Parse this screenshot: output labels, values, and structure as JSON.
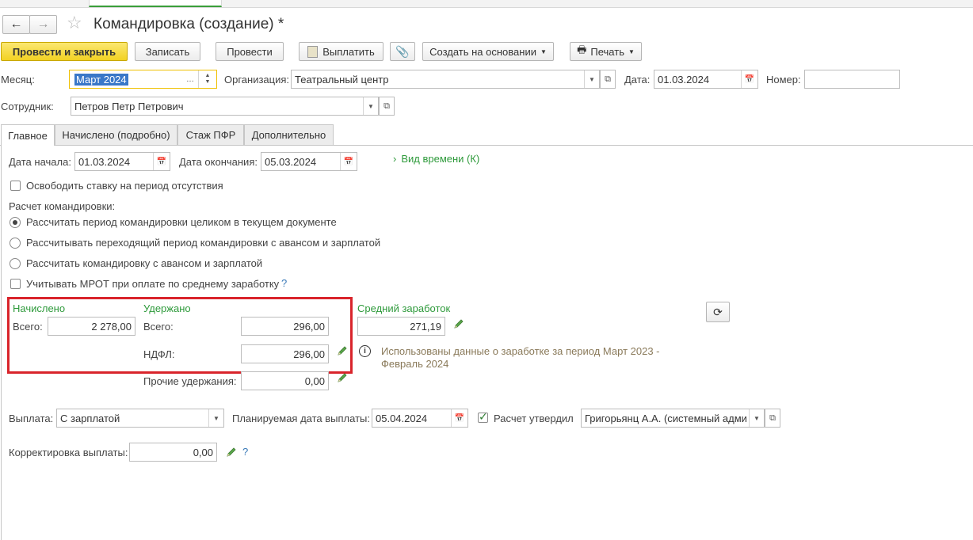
{
  "window": {
    "title": "Командировка (создание) *"
  },
  "toolbar": {
    "post_close": "Провести и закрыть",
    "save": "Записать",
    "post": "Провести",
    "pay": "Выплатить",
    "create_based": "Создать на основании",
    "print": "Печать"
  },
  "header": {
    "month_label": "Месяц:",
    "month_value": "Март 2024",
    "org_label": "Организация:",
    "org_value": "Театральный центр",
    "date_label": "Дата:",
    "date_value": "01.03.2024",
    "number_label": "Номер:",
    "number_value": "",
    "employee_label": "Сотрудник:",
    "employee_value": "Петров Петр Петрович"
  },
  "tabs": [
    {
      "label": "Главное"
    },
    {
      "label": "Начислено (подробно)"
    },
    {
      "label": "Стаж ПФР"
    },
    {
      "label": "Дополнительно"
    }
  ],
  "main": {
    "start_label": "Дата начала:",
    "start_value": "01.03.2024",
    "end_label": "Дата окончания:",
    "end_value": "05.03.2024",
    "time_type": "Вид времени (К)",
    "free_rate": "Освободить ставку на период отсутствия",
    "calc_title": "Расчет командировки:",
    "radio1": "Рассчитать период командировки целиком в текущем документе",
    "radio2": "Рассчитывать переходящий период командировки с авансом и зарплатой",
    "radio3": "Рассчитать командировку с авансом и зарплатой",
    "mrot": "Учитывать МРОТ при оплате по среднему заработку",
    "question": "?",
    "accrued_title": "Начислено",
    "accrued_total_label": "Всего:",
    "accrued_total_value": "2 278,00",
    "withheld_title": "Удержано",
    "withheld_total_label": "Всего:",
    "withheld_total_value": "296,00",
    "ndfl_label": "НДФЛ:",
    "ndfl_value": "296,00",
    "other_label": "Прочие удержания:",
    "other_value": "0,00",
    "avg_title": "Средний заработок",
    "avg_value": "271,19",
    "info_text_1": "Использованы данные о заработке за период Март 2023 -",
    "info_text_2": "Февраль 2024",
    "payout_label": "Выплата:",
    "payout_value": "С зарплатой",
    "planned_label": "Планируемая дата выплаты:",
    "planned_value": "05.04.2024",
    "approved_label": "Расчет утвердил",
    "approved_value": "Григорьянц А.А. (системный адми",
    "correction_label": "Корректировка выплаты:",
    "correction_value": "0,00"
  },
  "colors": {
    "accent_green": "#2e9a3b",
    "highlight_red": "#d9242b",
    "primary_yellow": "#f2d222"
  }
}
